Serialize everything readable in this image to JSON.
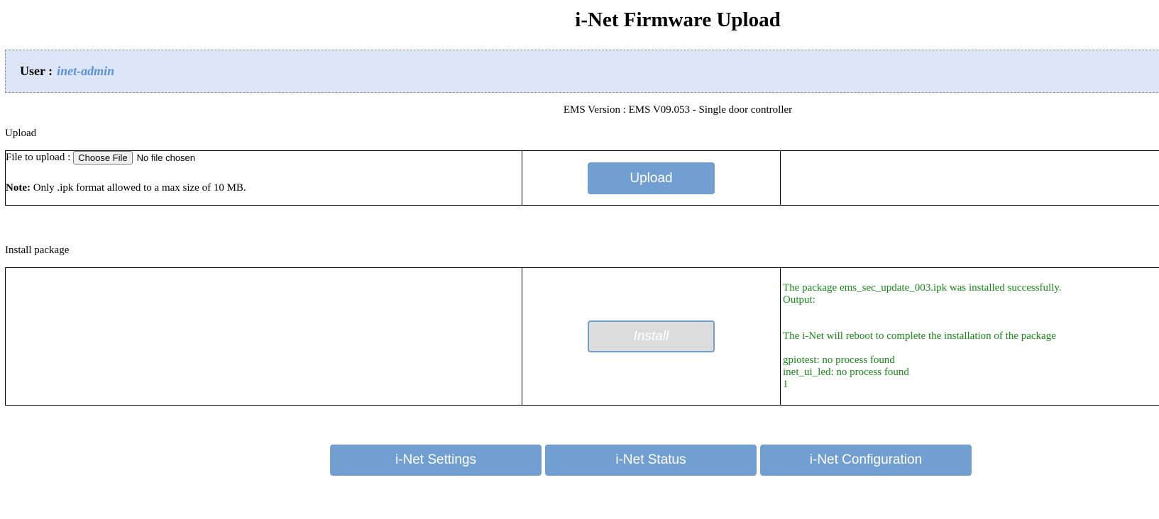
{
  "page": {
    "title": "i-Net Firmware Upload"
  },
  "user": {
    "label": "User :",
    "name": "inet-admin"
  },
  "ems_version": "EMS Version : EMS V09.053 - Single door controller",
  "upload_section": {
    "label": "Upload",
    "file_label": "File to upload :",
    "choose_file_label": "Choose File",
    "file_status": "No file chosen",
    "note_bold": "Note:",
    "note_text": "Only .ipk format allowed to a max size of 10 MB.",
    "upload_button": "Upload"
  },
  "install_section": {
    "label": "Install package",
    "install_button": "Install",
    "output_text": "The package ems_sec_update_003.ipk was installed successfully.\nOutput:\n\n\nThe i-Net will reboot to complete the installation of the package\n\ngpiotest: no process found\ninet_ui_led: no process found\n1"
  },
  "nav": {
    "settings": "i-Net Settings",
    "status": "i-Net Status",
    "configuration": "i-Net Configuration"
  },
  "colors": {
    "accent_button": "#729fd1",
    "user_bar_bg": "#dce6f7",
    "user_name": "#5b8fd9",
    "success_text": "#178a17"
  }
}
